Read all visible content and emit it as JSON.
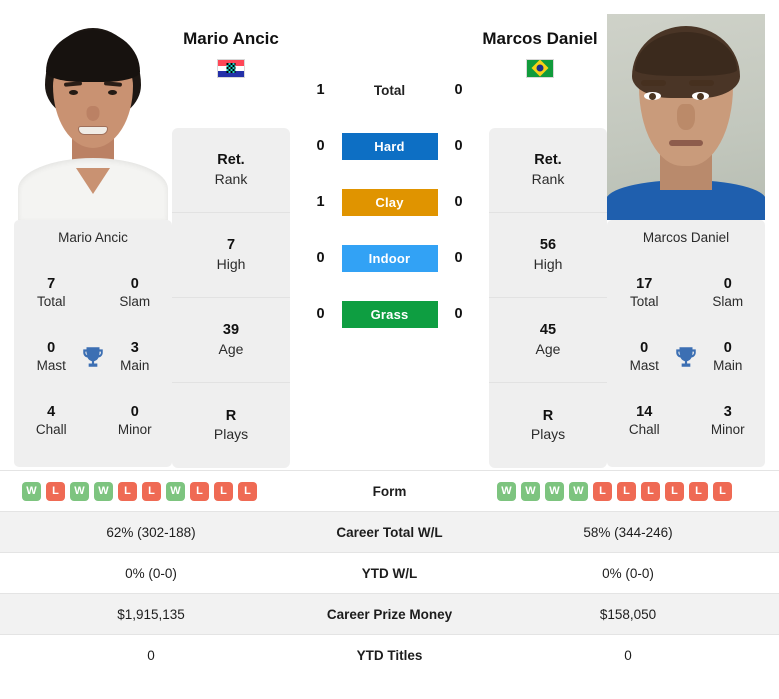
{
  "players": {
    "left": {
      "name": "Mario Ancic",
      "flag": "croatia-flag",
      "photo_caption": "Mario Ancic",
      "rank": "Ret.",
      "rank_label": "Rank",
      "high": "7",
      "high_label": "High",
      "age": "39",
      "age_label": "Age",
      "plays": "R",
      "plays_label": "Plays",
      "titles": {
        "total": "7",
        "total_label": "Total",
        "slam": "0",
        "slam_label": "Slam",
        "mast": "0",
        "mast_label": "Mast",
        "main": "3",
        "main_label": "Main",
        "chall": "4",
        "chall_label": "Chall",
        "minor": "0",
        "minor_label": "Minor"
      }
    },
    "right": {
      "name": "Marcos Daniel",
      "flag": "brazil-flag",
      "photo_caption": "Marcos Daniel",
      "rank": "Ret.",
      "rank_label": "Rank",
      "high": "56",
      "high_label": "High",
      "age": "45",
      "age_label": "Age",
      "plays": "R",
      "plays_label": "Plays",
      "titles": {
        "total": "17",
        "total_label": "Total",
        "slam": "0",
        "slam_label": "Slam",
        "mast": "0",
        "mast_label": "Mast",
        "main": "0",
        "main_label": "Main",
        "chall": "14",
        "chall_label": "Chall",
        "minor": "3",
        "minor_label": "Minor"
      }
    }
  },
  "h2h": {
    "rows": [
      {
        "label": "Total",
        "left": "1",
        "right": "0",
        "style": "plain",
        "color": ""
      },
      {
        "label": "Hard",
        "left": "0",
        "right": "0",
        "style": "pill",
        "color": "#0d6fc4"
      },
      {
        "label": "Clay",
        "left": "1",
        "right": "0",
        "style": "pill",
        "color": "#e09400"
      },
      {
        "label": "Indoor",
        "left": "0",
        "right": "0",
        "style": "pill",
        "color": "#32a2f5"
      },
      {
        "label": "Grass",
        "left": "0",
        "right": "0",
        "style": "pill",
        "color": "#0e9e41"
      }
    ]
  },
  "stats": {
    "form": {
      "label": "Form",
      "left": [
        "W",
        "L",
        "W",
        "W",
        "L",
        "L",
        "W",
        "L",
        "L",
        "L"
      ],
      "right": [
        "W",
        "W",
        "W",
        "W",
        "L",
        "L",
        "L",
        "L",
        "L",
        "L"
      ]
    },
    "rows": [
      {
        "label": "Career Total W/L",
        "left": "62% (302-188)",
        "right": "58% (344-246)"
      },
      {
        "label": "YTD W/L",
        "left": "0% (0-0)",
        "right": "0% (0-0)"
      },
      {
        "label": "Career Prize Money",
        "left": "$1,915,135",
        "right": "$158,050"
      },
      {
        "label": "YTD Titles",
        "left": "0",
        "right": "0"
      }
    ]
  },
  "colors": {
    "panel_bg": "#efefef",
    "win": "#7dc47f",
    "loss": "#ef6a54",
    "trophy": "#3c6fb3",
    "hard": "#0d6fc4",
    "clay": "#e09400",
    "indoor": "#32a2f5",
    "grass": "#0e9e41"
  }
}
